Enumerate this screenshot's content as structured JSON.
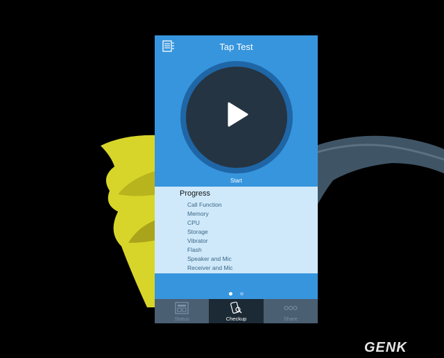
{
  "app": {
    "title": "Tap Test",
    "menu_icon": "list-icon"
  },
  "dial": {
    "button_icon": "play-icon",
    "start_label": "Start"
  },
  "progress": {
    "title": "Progress",
    "items": [
      "Call Function",
      "Memory",
      "CPU",
      "Storage",
      "Vibrator",
      "Flash",
      "Speaker and Mic",
      "Receiver and Mic"
    ]
  },
  "pager": {
    "total": 2,
    "active_index": 0
  },
  "tabs": [
    {
      "label": "Status",
      "icon": "status-icon",
      "active": false
    },
    {
      "label": "Checkup",
      "icon": "phone-search-icon",
      "active": true
    },
    {
      "label": "Share",
      "icon": "more-dots-icon",
      "active": false
    }
  ],
  "watermark": "GENK",
  "colors": {
    "app_blue": "#3795dd",
    "dial_ring": "#1f66a6",
    "dial_center": "#253443",
    "progress_bg": "#cfe9fb",
    "tabbar": "#4b5f72",
    "tab_active": "#1c2a36"
  }
}
